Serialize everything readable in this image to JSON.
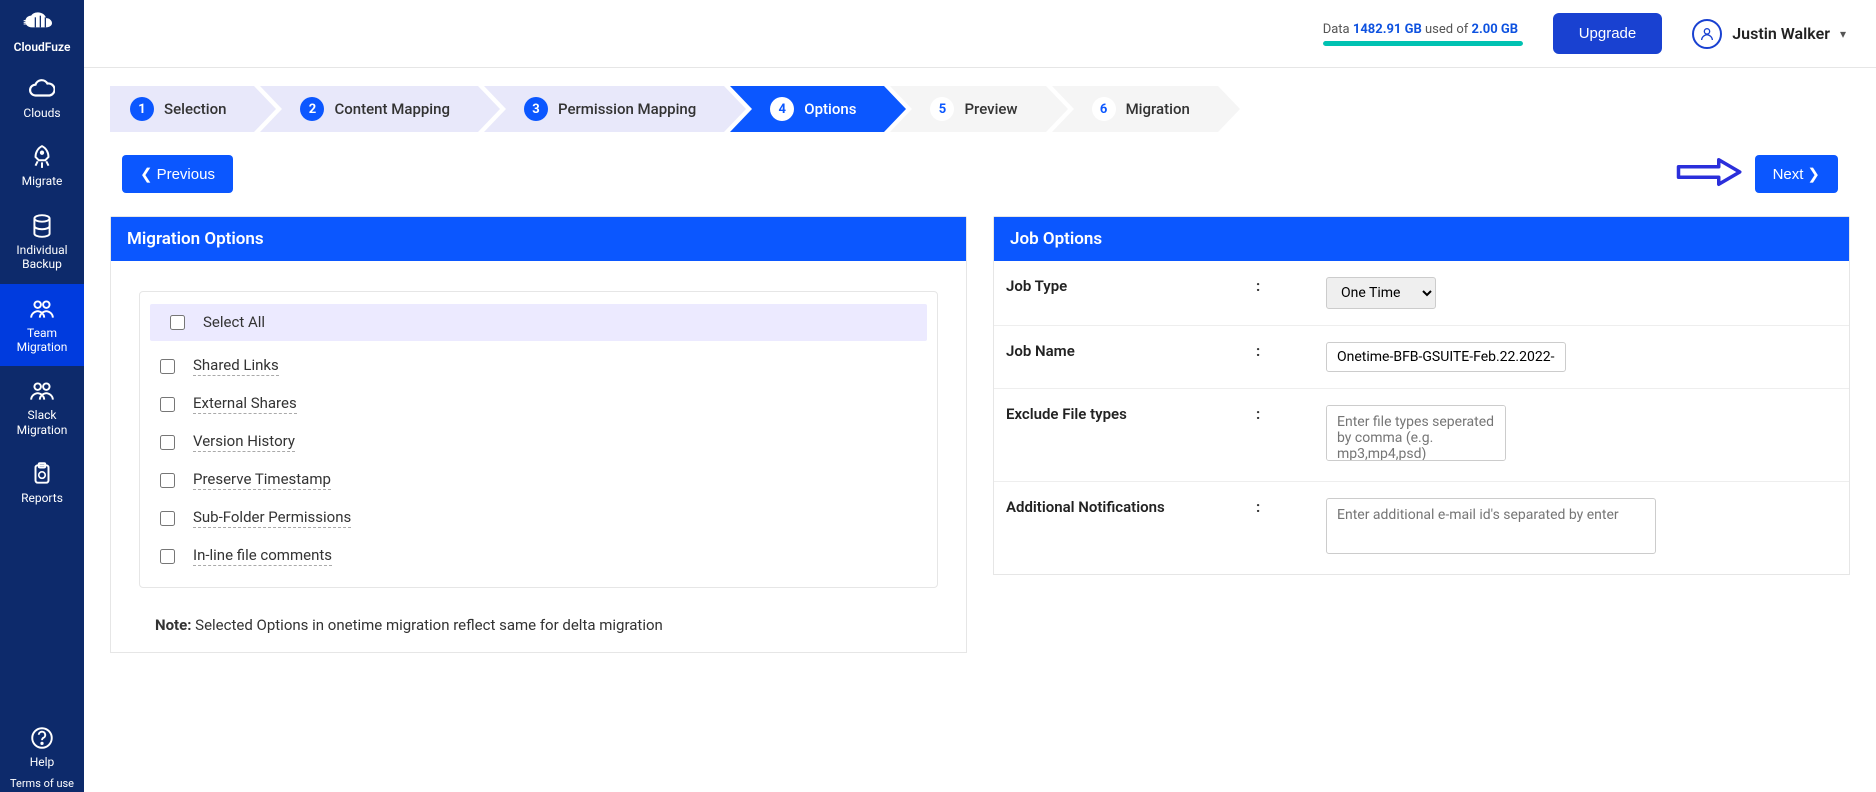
{
  "brand": "CloudFuze",
  "sidebar": {
    "items": [
      {
        "label": "Clouds"
      },
      {
        "label": "Migrate"
      },
      {
        "label": "Individual Backup"
      },
      {
        "label": "Team Migration"
      },
      {
        "label": "Slack Migration"
      },
      {
        "label": "Reports"
      }
    ],
    "help": "Help",
    "terms": "Terms of use"
  },
  "topbar": {
    "data_prefix": "Data ",
    "data_used": "1482.91 GB",
    "data_middle": " used of ",
    "data_total": "2.00 GB",
    "upgrade": "Upgrade",
    "user_name": "Justin Walker"
  },
  "stepper": [
    {
      "num": "1",
      "label": "Selection"
    },
    {
      "num": "2",
      "label": "Content Mapping"
    },
    {
      "num": "3",
      "label": "Permission Mapping"
    },
    {
      "num": "4",
      "label": "Options"
    },
    {
      "num": "5",
      "label": "Preview"
    },
    {
      "num": "6",
      "label": "Migration"
    }
  ],
  "nav": {
    "previous": "Previous",
    "next": "Next"
  },
  "migration_options": {
    "title": "Migration Options",
    "select_all": "Select All",
    "items": [
      "Shared Links",
      "External Shares",
      "Version History",
      "Preserve Timestamp",
      "Sub-Folder Permissions",
      "In-line file comments"
    ],
    "note_label": "Note:",
    "note_text": " Selected Options in onetime migration reflect same for delta migration"
  },
  "job_options": {
    "title": "Job Options",
    "rows": {
      "job_type": {
        "label": "Job Type",
        "value": "One Time"
      },
      "job_name": {
        "label": "Job Name",
        "value": "Onetime-BFB-GSUITE-Feb.22.2022-"
      },
      "exclude": {
        "label": "Exclude File types",
        "placeholder": "Enter file types seperated by comma (e.g. mp3,mp4,psd)"
      },
      "notify": {
        "label": "Additional Notifications",
        "placeholder": "Enter additional e-mail id's separated by enter"
      }
    }
  }
}
